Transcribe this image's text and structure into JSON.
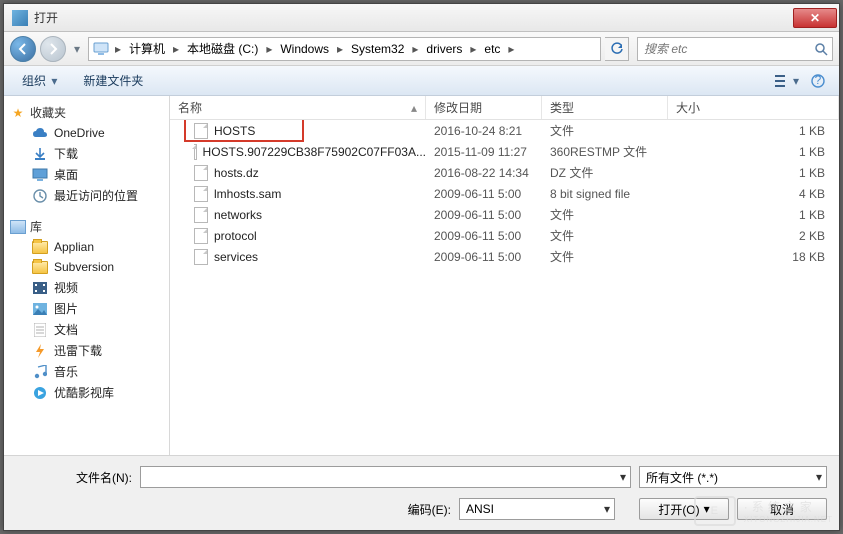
{
  "window": {
    "title": "打开",
    "close_glyph": "✕"
  },
  "nav": {
    "breadcrumb": [
      "计算机",
      "本地磁盘 (C:)",
      "Windows",
      "System32",
      "drivers",
      "etc"
    ],
    "search_placeholder": "搜索 etc"
  },
  "toolbar": {
    "organize": "组织",
    "new_folder": "新建文件夹"
  },
  "sidebar": {
    "favorites_title": "收藏夹",
    "favorites": [
      {
        "label": "OneDrive",
        "icon": "cloud"
      },
      {
        "label": "下载",
        "icon": "download"
      },
      {
        "label": "桌面",
        "icon": "desktop"
      },
      {
        "label": "最近访问的位置",
        "icon": "recent"
      }
    ],
    "libraries_title": "库",
    "libraries": [
      {
        "label": "Applian",
        "icon": "folder"
      },
      {
        "label": "Subversion",
        "icon": "folder"
      },
      {
        "label": "视频",
        "icon": "video"
      },
      {
        "label": "图片",
        "icon": "picture"
      },
      {
        "label": "文档",
        "icon": "document"
      },
      {
        "label": "迅雷下载",
        "icon": "thunder"
      },
      {
        "label": "音乐",
        "icon": "music"
      },
      {
        "label": "优酷影视库",
        "icon": "youku"
      }
    ]
  },
  "columns": {
    "name": "名称",
    "date": "修改日期",
    "type": "类型",
    "size": "大小"
  },
  "files": [
    {
      "name": "HOSTS",
      "date": "2016-10-24 8:21",
      "type": "文件",
      "size": "1 KB",
      "highlighted": true
    },
    {
      "name": "HOSTS.907229CB38F75902C07FF03A...",
      "date": "2015-11-09 11:27",
      "type": "360RESTMP 文件",
      "size": "1 KB"
    },
    {
      "name": "hosts.dz",
      "date": "2016-08-22 14:34",
      "type": "DZ 文件",
      "size": "1 KB"
    },
    {
      "name": "lmhosts.sam",
      "date": "2009-06-11 5:00",
      "type": "8 bit signed file",
      "size": "4 KB"
    },
    {
      "name": "networks",
      "date": "2009-06-11 5:00",
      "type": "文件",
      "size": "1 KB"
    },
    {
      "name": "protocol",
      "date": "2009-06-11 5:00",
      "type": "文件",
      "size": "2 KB"
    },
    {
      "name": "services",
      "date": "2009-06-11 5:00",
      "type": "文件",
      "size": "18 KB"
    }
  ],
  "bottom": {
    "filename_label": "文件名(N):",
    "filename_value": "",
    "filter_label": "所有文件 (*.*)",
    "encoding_label": "编码(E):",
    "encoding_value": "ANSI",
    "open_label": "打开(O)",
    "cancel_label": "取消"
  },
  "watermark": {
    "logo": "E",
    "text": "·系统之家",
    "sub": "XITONGZHIJIA.NET"
  }
}
